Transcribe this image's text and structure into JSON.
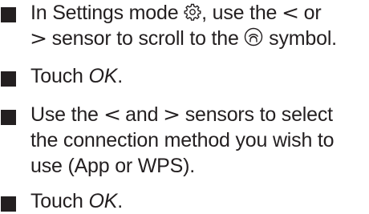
{
  "steps": [
    {
      "line1": {
        "before_gear": "In Settings mode ",
        "gear_icon": "gear-icon",
        "after_gear": ", use the ",
        "less": "<",
        "after_less": " or"
      },
      "line2": {
        "greater": ">",
        "before_symbol": " sensor to scroll to the ",
        "wifi_icon": "wifi-connection-icon",
        "after_symbol": " symbol."
      }
    },
    {
      "prefix": "Touch ",
      "emphasis": "OK",
      "suffix": "."
    },
    {
      "line1": {
        "before_less": "Use the ",
        "less": "<",
        "between": " and ",
        "greater": ">",
        "after_greater": " sensors to select"
      },
      "line2": "the connection method you wish to",
      "line3": "use (App or WPS)."
    },
    {
      "prefix": "Touch ",
      "emphasis": "OK",
      "suffix": "."
    }
  ],
  "colors": {
    "text": "#231f20",
    "bullet": "#231f20",
    "background": "#ffffff"
  }
}
